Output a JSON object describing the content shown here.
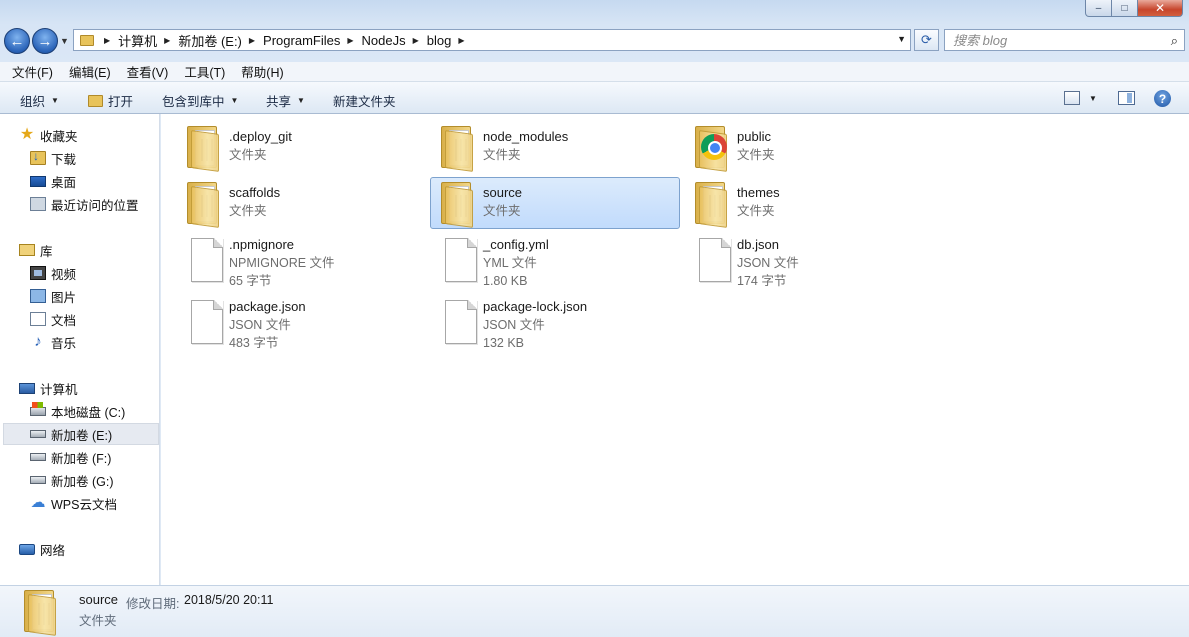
{
  "window": {
    "min_label": "–",
    "max_label": "□",
    "close_label": "✕"
  },
  "nav": {
    "back_glyph": "←",
    "forward_glyph": "→",
    "dropdown_glyph": "▼",
    "breadcrumbs": [
      "计算机",
      "新加卷 (E:)",
      "ProgramFiles",
      "NodeJs",
      "blog"
    ],
    "crumb_separator": "▶",
    "refresh_glyph": "⟳",
    "search_placeholder": "搜索 blog",
    "search_glyph": "⌕"
  },
  "menu": [
    "文件(F)",
    "编辑(E)",
    "查看(V)",
    "工具(T)",
    "帮助(H)"
  ],
  "commands": {
    "organize": "组织",
    "open": "打开",
    "include_in_library": "包含到库中",
    "share": "共享",
    "new_folder": "新建文件夹",
    "caret": "▼",
    "help": "?"
  },
  "sidebar": {
    "favorites": {
      "label": "收藏夹",
      "items": [
        "下载",
        "桌面",
        "最近访问的位置"
      ]
    },
    "libraries": {
      "label": "库",
      "items": [
        "视频",
        "图片",
        "文档",
        "音乐"
      ]
    },
    "computer": {
      "label": "计算机",
      "items": [
        "本地磁盘 (C:)",
        "新加卷 (E:)",
        "新加卷 (F:)",
        "新加卷 (G:)",
        "WPS云文档"
      ]
    },
    "network": {
      "label": "网络"
    },
    "selected_item": "新加卷 (E:)"
  },
  "folders": [
    {
      "name": ".deploy_git",
      "type": "文件夹",
      "icon": "folder-icon"
    },
    {
      "name": "node_modules",
      "type": "文件夹",
      "icon": "folder-icon"
    },
    {
      "name": "public",
      "type": "文件夹",
      "icon": "chrome-folder-icon"
    },
    {
      "name": "scaffolds",
      "type": "文件夹",
      "icon": "folder-icon"
    },
    {
      "name": "source",
      "type": "文件夹",
      "icon": "folder-icon",
      "selected": true
    },
    {
      "name": "themes",
      "type": "文件夹",
      "icon": "folder-icon"
    }
  ],
  "files": [
    {
      "name": ".npmignore",
      "type": "NPMIGNORE 文件",
      "size": "65 字节"
    },
    {
      "name": "_config.yml",
      "type": "YML 文件",
      "size": "1.80 KB"
    },
    {
      "name": "db.json",
      "type": "JSON 文件",
      "size": "174 字节"
    },
    {
      "name": "package.json",
      "type": "JSON 文件",
      "size": "483 字节"
    },
    {
      "name": "package-lock.json",
      "type": "JSON 文件",
      "size": "132 KB"
    }
  ],
  "details": {
    "name": "source",
    "modified_label": "修改日期:",
    "modified_value": "2018/5/20 20:11",
    "type": "文件夹"
  }
}
